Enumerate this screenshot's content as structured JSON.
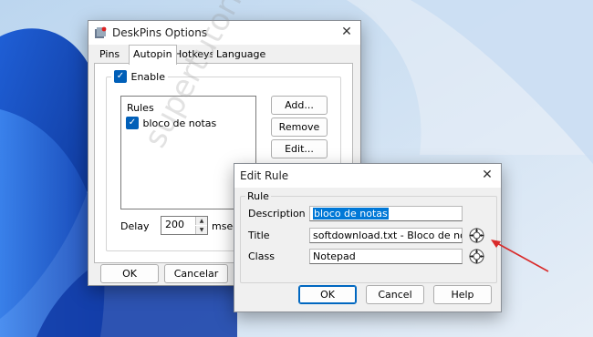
{
  "colors": {
    "accent": "#005fb8",
    "selection": "#0078d7",
    "arrow": "#d92a2a"
  },
  "deskpins": {
    "title": "DeskPins Options",
    "close_icon": "close-icon",
    "tabs": [
      "Pins",
      "Autopin",
      "Hotkeys",
      "Language"
    ],
    "active_tab": "Autopin",
    "enable_label": "Enable",
    "enable_checked": true,
    "rules_label": "Rules",
    "rules": [
      {
        "label": "bloco de notas",
        "checked": true
      }
    ],
    "buttons": {
      "add": "Add...",
      "remove": "Remove",
      "edit": "Edit..."
    },
    "delay_label": "Delay",
    "delay_value": "200",
    "delay_unit": "msec",
    "ok": "OK",
    "cancel": "Cancelar"
  },
  "editrule": {
    "title": "Edit Rule",
    "group_label": "Rule",
    "description_label": "Description",
    "description_value": "bloco de notas",
    "title_label": "Title",
    "title_value": "softdownload.txt - Bloco de notas",
    "class_label": "Class",
    "class_value": "Notepad",
    "ok": "OK",
    "cancel": "Cancel",
    "help": "Help"
  },
  "watermark": "supertutoriais.com.br"
}
